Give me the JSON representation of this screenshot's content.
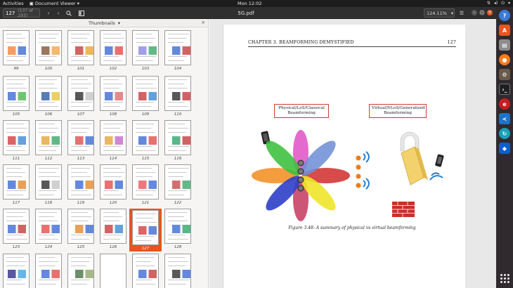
{
  "topbar": {
    "activities": "Activities",
    "app_menu": "Document Viewer",
    "clock": "Mon 12:02"
  },
  "toolbar": {
    "page_number": "127",
    "page_count": "(137 of 293)",
    "document_title": "5G.pdf",
    "zoom": "124.11%"
  },
  "sidebar": {
    "mode": "Thumbnails",
    "thumbnails": [
      {
        "label": "99"
      },
      {
        "label": "100"
      },
      {
        "label": "101"
      },
      {
        "label": "102"
      },
      {
        "label": "103"
      },
      {
        "label": "104"
      },
      {
        "label": "105"
      },
      {
        "label": "106"
      },
      {
        "label": "107"
      },
      {
        "label": "108"
      },
      {
        "label": "109"
      },
      {
        "label": "110"
      },
      {
        "label": "111"
      },
      {
        "label": "112"
      },
      {
        "label": "113"
      },
      {
        "label": "114"
      },
      {
        "label": "115"
      },
      {
        "label": "116"
      },
      {
        "label": "117"
      },
      {
        "label": "118"
      },
      {
        "label": "119"
      },
      {
        "label": "120"
      },
      {
        "label": "121"
      },
      {
        "label": "122"
      },
      {
        "label": "123"
      },
      {
        "label": "124"
      },
      {
        "label": "125"
      },
      {
        "label": "126"
      },
      {
        "label": "127"
      },
      {
        "label": "128"
      },
      {
        "label": ""
      },
      {
        "label": ""
      },
      {
        "label": ""
      },
      {
        "label": ""
      },
      {
        "label": ""
      },
      {
        "label": ""
      }
    ],
    "selected_label": "127"
  },
  "document": {
    "running_head_left": "CHAPTER 3.  BEAMFORMING DEMYSTIFIED",
    "running_head_right": "127",
    "figure_box_left": "Physical/LoS/Classical\nBeamforming",
    "figure_box_right": "Virtual/NLoS/Generalized\nBeamforming",
    "caption": "Figure 3.48: A summary of physical vs virtual beamforming"
  },
  "colors": {
    "accent": "#e95420",
    "topbar": "#1d1d1d",
    "headerbar": "#2f2f2f",
    "dock": "#302a2e"
  },
  "dock": {
    "apps": [
      "help-icon",
      "software-center-icon",
      "files-icon",
      "firefox-icon",
      "settings-icon",
      "terminal-icon",
      "document-viewer-icon",
      "vscode-icon",
      "sync-icon",
      "dropbox-icon"
    ]
  }
}
